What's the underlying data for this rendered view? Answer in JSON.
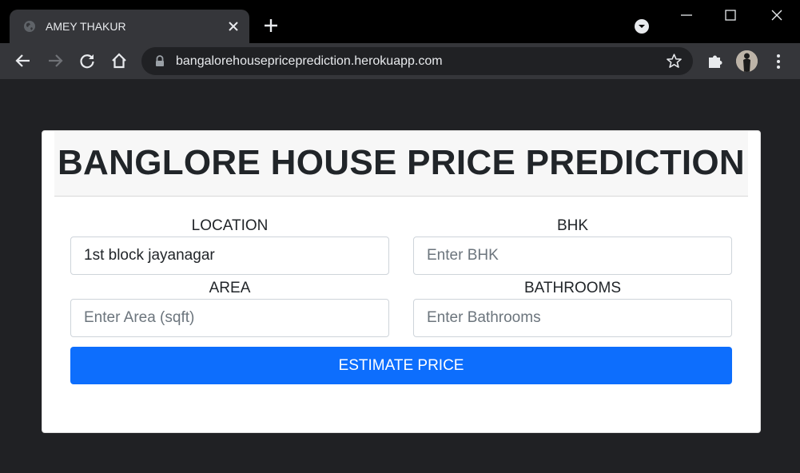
{
  "browser": {
    "tab_title": "AMEY THAKUR",
    "url": "bangalorehousepriceprediction.herokuapp.com"
  },
  "page": {
    "title": "BANGLORE HOUSE PRICE PREDICTION",
    "fields": {
      "location": {
        "label": "LOCATION",
        "value": "1st block jayanagar"
      },
      "bhk": {
        "label": "BHK",
        "placeholder": "Enter BHK"
      },
      "area": {
        "label": "AREA",
        "placeholder": "Enter Area (sqft)"
      },
      "bathrooms": {
        "label": "BATHROOMS",
        "placeholder": "Enter Bathrooms"
      }
    },
    "estimate_label": "ESTIMATE PRICE"
  },
  "colors": {
    "button": "#0d6efd",
    "page_background": "#202124",
    "header_background": "#f7f7f7"
  }
}
